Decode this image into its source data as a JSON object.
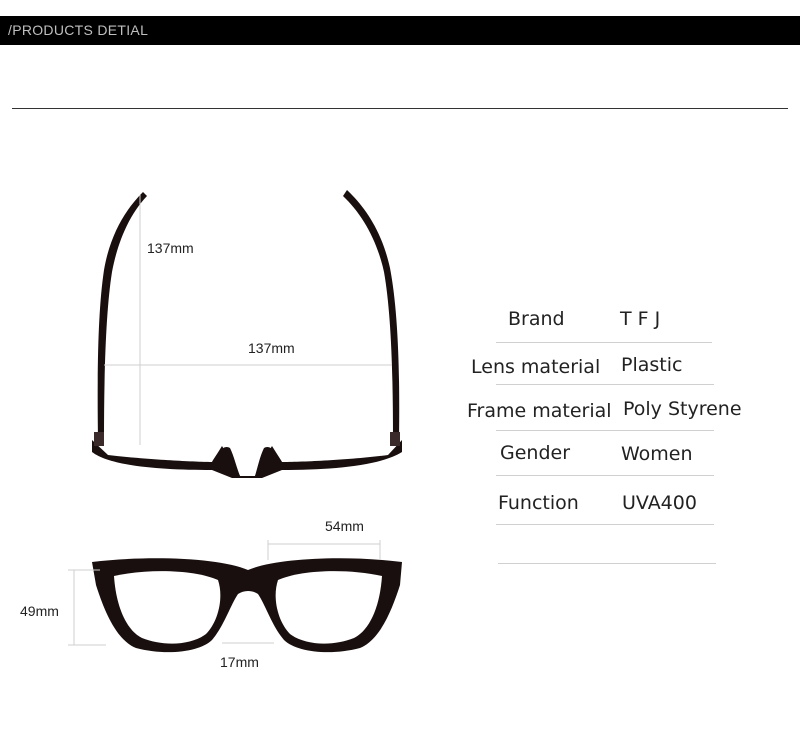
{
  "header": {
    "title": "/PRODUCTS DETIAL"
  },
  "dimensions": {
    "temple_length": "137mm",
    "frame_width": "137mm",
    "lens_width": "54mm",
    "lens_height": "49mm",
    "bridge_width": "17mm"
  },
  "specs": [
    {
      "label": "Brand",
      "value": "T F J"
    },
    {
      "label": "Lens material",
      "value": "Plastic"
    },
    {
      "label": "Frame material",
      "value": "Poly Styrene"
    },
    {
      "label": "Gender",
      "value": "Women"
    },
    {
      "label": "Function",
      "value": "UVA400"
    }
  ],
  "colors": {
    "header_bg": "#000000",
    "header_text": "#bfbfbf",
    "frame": "#1a0f0f",
    "rule": "#d0d0d0"
  }
}
